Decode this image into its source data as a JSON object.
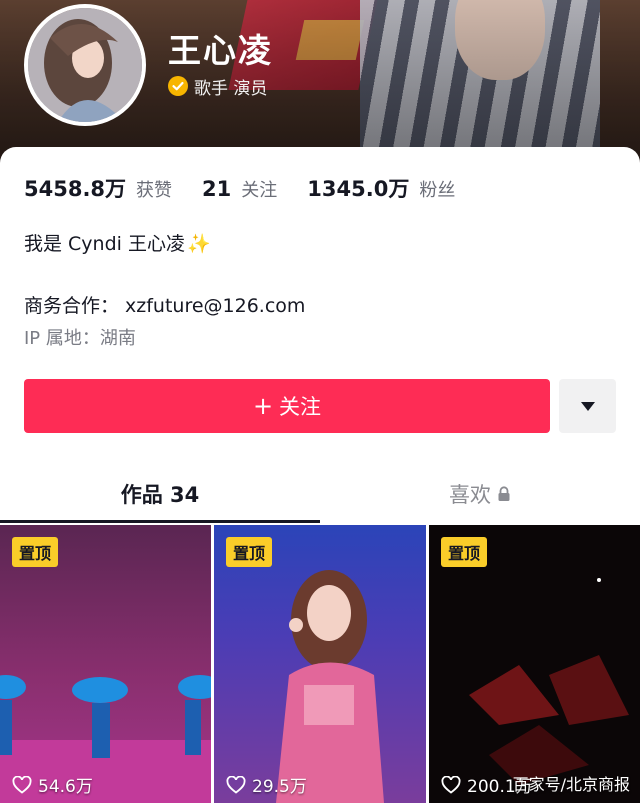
{
  "profile": {
    "name": "王心凌",
    "verify_text": "歌手 演员"
  },
  "stats": [
    {
      "value": "5458.8万",
      "label": "获赞"
    },
    {
      "value": "21",
      "label": "关注"
    },
    {
      "value": "1345.0万",
      "label": "粉丝"
    }
  ],
  "bio": {
    "text": "我是 Cyndi 王心凌",
    "sparkle": "✨"
  },
  "contact": {
    "label": "商务合作：",
    "email": "xzfuture@126.com"
  },
  "ip": "IP 属地：湖南",
  "follow": {
    "plus": "+",
    "label": "关注"
  },
  "tabs": {
    "works": "作品 34",
    "likes": "喜欢"
  },
  "videos": [
    {
      "pin": "置顶",
      "likes": "54.6万"
    },
    {
      "pin": "置顶",
      "likes": "29.5万"
    },
    {
      "pin": "置顶",
      "likes": "200.1万"
    }
  ],
  "watermark": "百家号/北京商报",
  "colors": {
    "accent": "#fe2c55",
    "pin_badge": "#facd29",
    "verify": "#f7b500"
  },
  "icons": {
    "verify": "verified-badge-icon",
    "more": "triangle-down-icon",
    "lock": "lock-icon",
    "heart": "heart-outline-icon"
  }
}
